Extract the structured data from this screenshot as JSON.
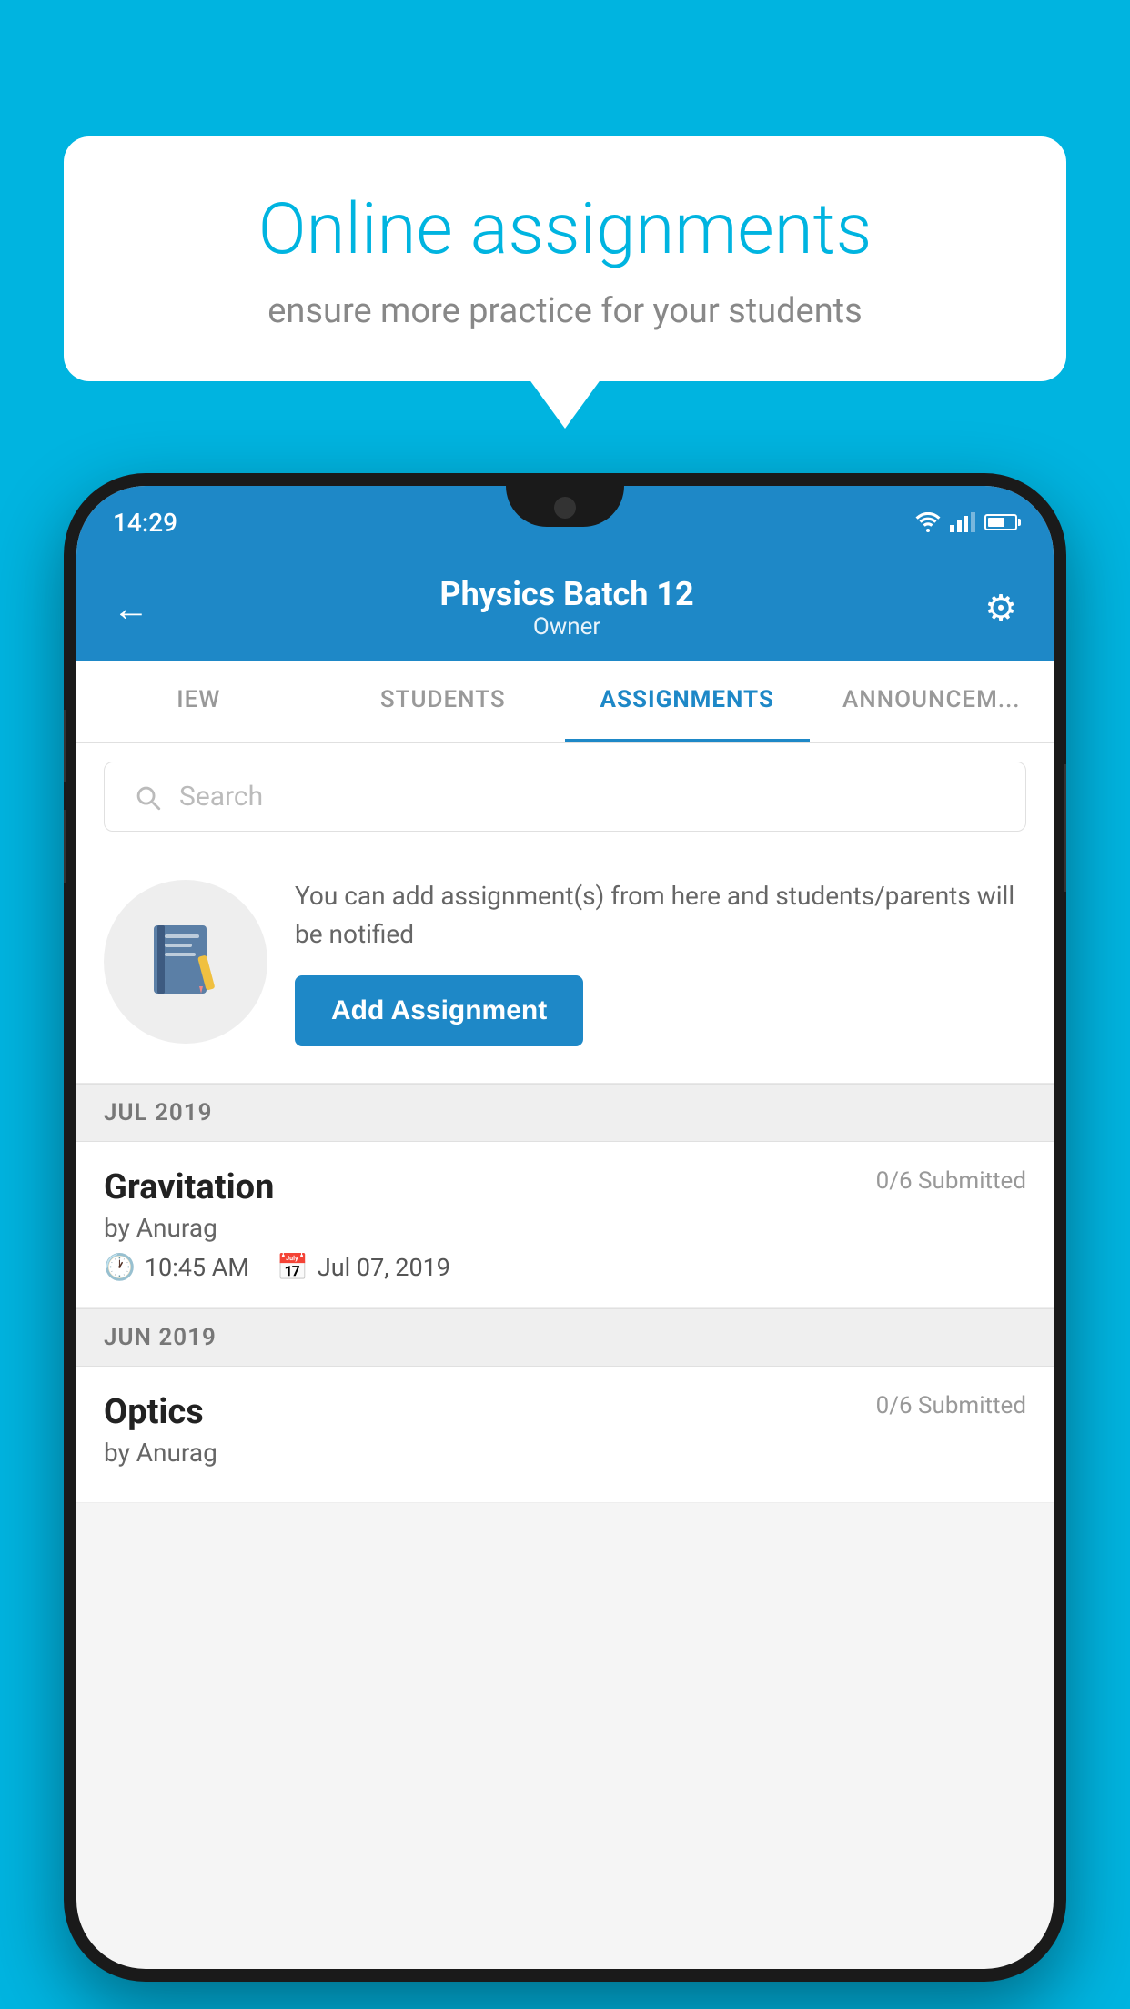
{
  "background_color": "#00B4E0",
  "speech_bubble": {
    "title": "Online assignments",
    "subtitle": "ensure more practice for your students"
  },
  "status_bar": {
    "time": "14:29"
  },
  "app_header": {
    "title": "Physics Batch 12",
    "subtitle": "Owner",
    "back_label": "←",
    "settings_label": "⚙"
  },
  "tabs": [
    {
      "label": "IEW",
      "active": false
    },
    {
      "label": "STUDENTS",
      "active": false
    },
    {
      "label": "ASSIGNMENTS",
      "active": true
    },
    {
      "label": "ANNOUNCEM...",
      "active": false
    }
  ],
  "search": {
    "placeholder": "Search"
  },
  "promo": {
    "text": "You can add assignment(s) from here and students/parents will be notified",
    "button_label": "Add Assignment"
  },
  "sections": [
    {
      "header": "JUL 2019",
      "assignments": [
        {
          "name": "Gravitation",
          "submitted": "0/6 Submitted",
          "by": "by Anurag",
          "time": "10:45 AM",
          "date": "Jul 07, 2019"
        }
      ]
    },
    {
      "header": "JUN 2019",
      "assignments": [
        {
          "name": "Optics",
          "submitted": "0/6 Submitted",
          "by": "by Anurag",
          "time": "",
          "date": ""
        }
      ]
    }
  ]
}
